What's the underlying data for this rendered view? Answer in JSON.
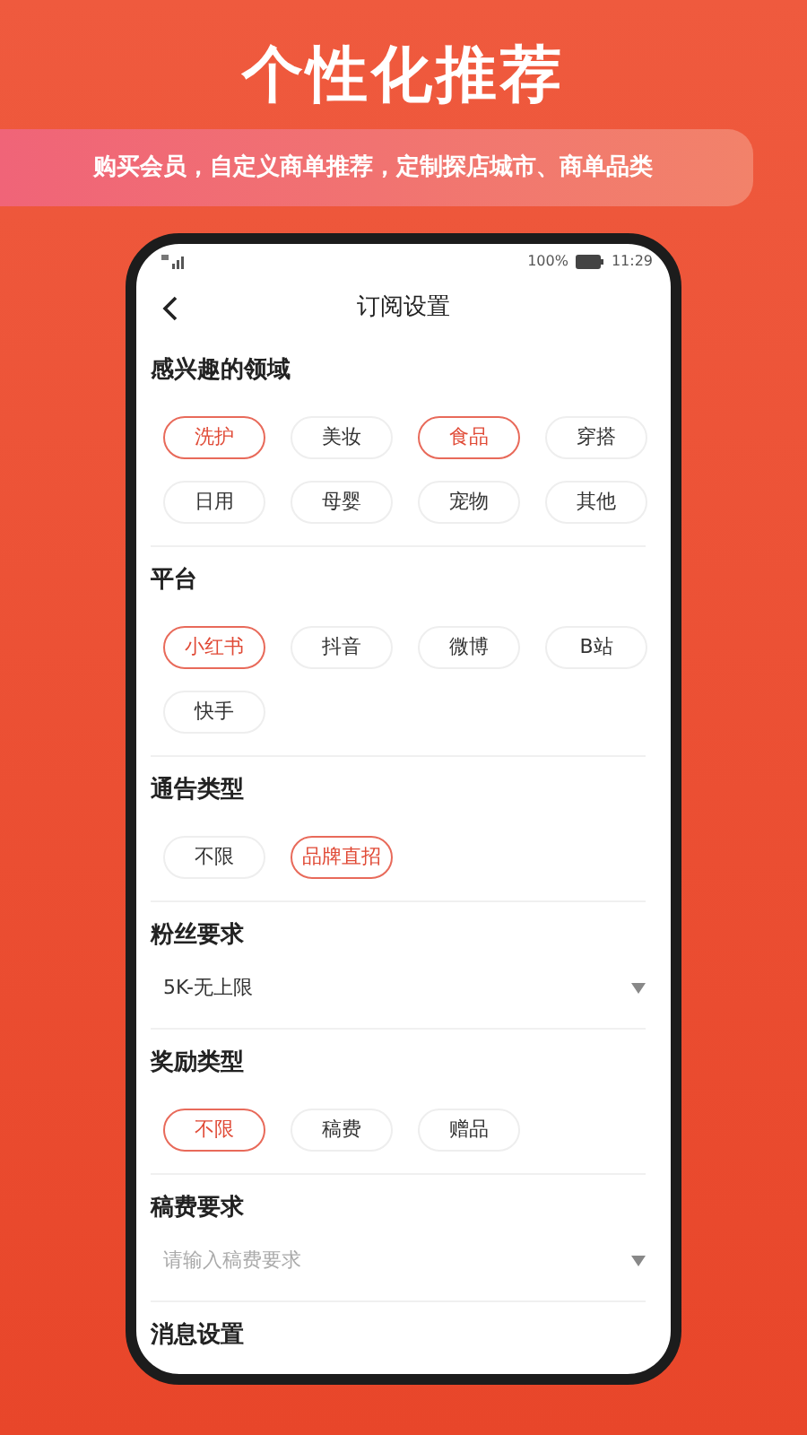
{
  "headline": "个性化推荐",
  "subtitle": "购买会员，自定义商单推荐，定制探店城市、商单品类",
  "status_bar": {
    "battery": "100%",
    "time": "11:29"
  },
  "nav": {
    "title": "订阅设置"
  },
  "sections": [
    {
      "kind": "chips",
      "title": "感兴趣的领域",
      "options": [
        {
          "label": "洗护",
          "selected": true
        },
        {
          "label": "美妆",
          "selected": false
        },
        {
          "label": "食品",
          "selected": true
        },
        {
          "label": "穿搭",
          "selected": false
        },
        {
          "label": "日用",
          "selected": false
        },
        {
          "label": "母婴",
          "selected": false
        },
        {
          "label": "宠物",
          "selected": false
        },
        {
          "label": "其他",
          "selected": false
        }
      ]
    },
    {
      "kind": "chips",
      "title": "平台",
      "options": [
        {
          "label": "小红书",
          "selected": true
        },
        {
          "label": "抖音",
          "selected": false
        },
        {
          "label": "微博",
          "selected": false
        },
        {
          "label": "B站",
          "selected": false
        },
        {
          "label": "快手",
          "selected": false
        }
      ]
    },
    {
      "kind": "chips",
      "title": "通告类型",
      "options": [
        {
          "label": "不限",
          "selected": false
        },
        {
          "label": "品牌直招",
          "selected": true
        }
      ]
    },
    {
      "kind": "select",
      "title": "粉丝要求",
      "value": "5K-无上限"
    },
    {
      "kind": "chips",
      "title": "奖励类型",
      "options": [
        {
          "label": "不限",
          "selected": true
        },
        {
          "label": "稿费",
          "selected": false
        },
        {
          "label": "赠品",
          "selected": false
        }
      ]
    },
    {
      "kind": "select",
      "title": "稿费要求",
      "placeholder": "请输入稿费要求"
    },
    {
      "kind": "header",
      "title": "消息设置"
    }
  ]
}
